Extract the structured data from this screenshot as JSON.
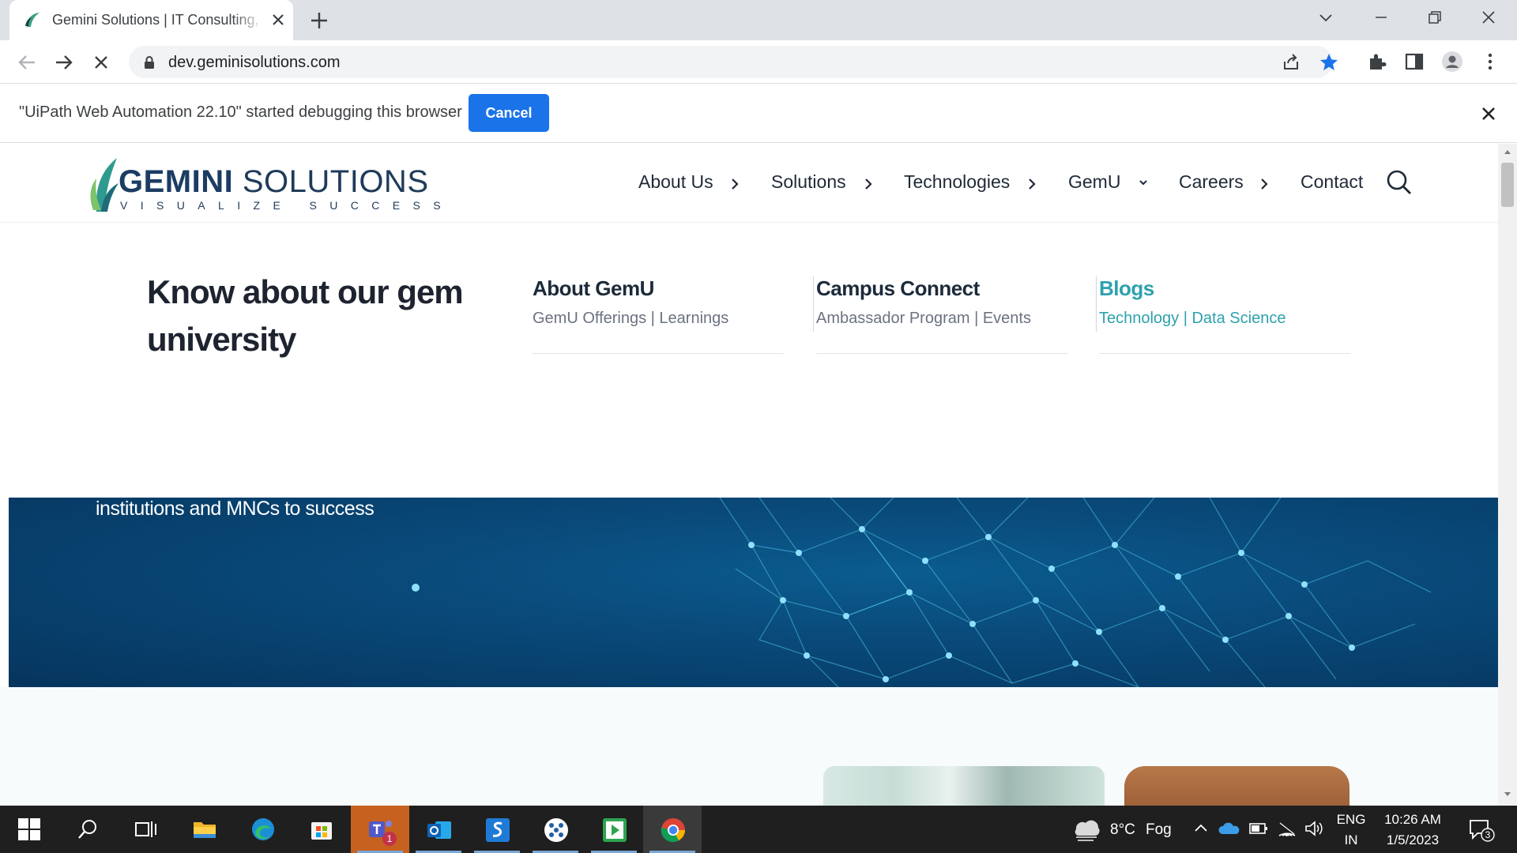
{
  "browser": {
    "tab_title": "Gemini Solutions | IT Consulting, Outsourcing",
    "url": "dev.geminisolutions.com"
  },
  "infobar": {
    "message": "\"UiPath Web Automation 22.10\" started debugging this browser",
    "cancel_label": "Cancel"
  },
  "site": {
    "logo_word1": "GEMINI",
    "logo_word2": " SOLUTIONS",
    "logo_tagline": "VISUALIZE SUCCESS",
    "nav": [
      "About Us",
      "Solutions",
      "Technologies",
      "GemU",
      "Careers",
      "Contact"
    ],
    "mega": {
      "heading": "Know about our gem university",
      "columns": [
        {
          "title": "About GemU",
          "sub": "GemU Offerings | Learnings"
        },
        {
          "title": "Campus Connect",
          "sub": "Ambassador Program | Events"
        },
        {
          "title": "Blogs",
          "sub": "Technology | Data Science"
        }
      ]
    },
    "hero_text": "institutions and MNCs to success"
  },
  "taskbar": {
    "weather_temp": "8°C",
    "weather_desc": "Fog",
    "lang": "ENG",
    "region": "IN",
    "time": "10:26 AM",
    "date": "1/5/2023",
    "notification_count": "3",
    "teams_badge": "1"
  },
  "colors": {
    "accent_blue": "#1a73e8",
    "teal_link": "#2da1ad",
    "logo_navy": "#1c3c63",
    "hero_blue": "#094a7a"
  }
}
